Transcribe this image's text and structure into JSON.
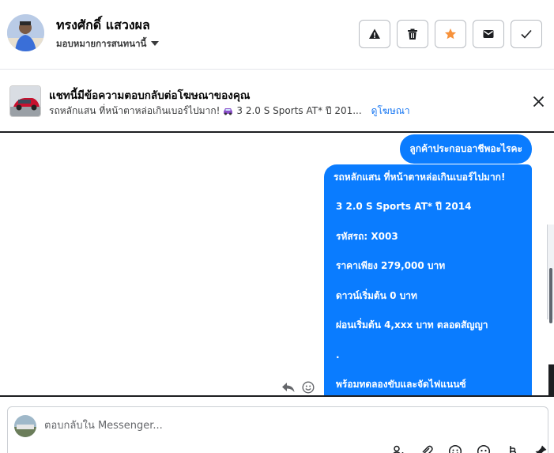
{
  "header": {
    "name": "ทรงศักดิ์ แสวงผล",
    "assign_label": "มอบหมายการสนทนานี้",
    "actions": [
      {
        "icon": "warning-icon"
      },
      {
        "icon": "trash-icon"
      },
      {
        "icon": "star-icon"
      },
      {
        "icon": "mail-icon"
      },
      {
        "icon": "check-icon"
      }
    ]
  },
  "ad": {
    "title": "แชทนี้มีข้อความตอบกลับต่อโฆษณาของคุณ",
    "subtitle_text": "รถหลักแสน ที่หน้าตาหล่อเกินเบอร์ไปมาก!",
    "subtitle_suffix": "3 2.0 S Sports AT* ปี 201...",
    "link": "ดูโฆษณา"
  },
  "messages": {
    "top": "ลูกค้าประกอบอาชีพอะไรคะ",
    "main_lines": [
      "รถหลักแสน ที่หน้าตาหล่อเกินเบอร์ไปมาก!",
      "3 2.0 S Sports AT* ปี 2014",
      "รหัสรถ: X003",
      "ราคาเพียง 279,000 บาท",
      "ดาวน์เริ่มต้น 0 บาท",
      "ผ่อนเริ่มต้น 4,xxx บาท ตลอดสัญญา",
      ".",
      "พร้อมทดลองขับและจัดไฟแนนซ์"
    ]
  },
  "composer": {
    "placeholder": "ตอบกลับใน Messenger...",
    "tools": [
      "add-person-icon",
      "attach-icon",
      "emoji-icon",
      "smiley-icon",
      "baht-icon",
      "pin-icon"
    ]
  },
  "colors": {
    "accent": "#0a7cff",
    "star": "#f7923b",
    "link": "#1877f2"
  }
}
